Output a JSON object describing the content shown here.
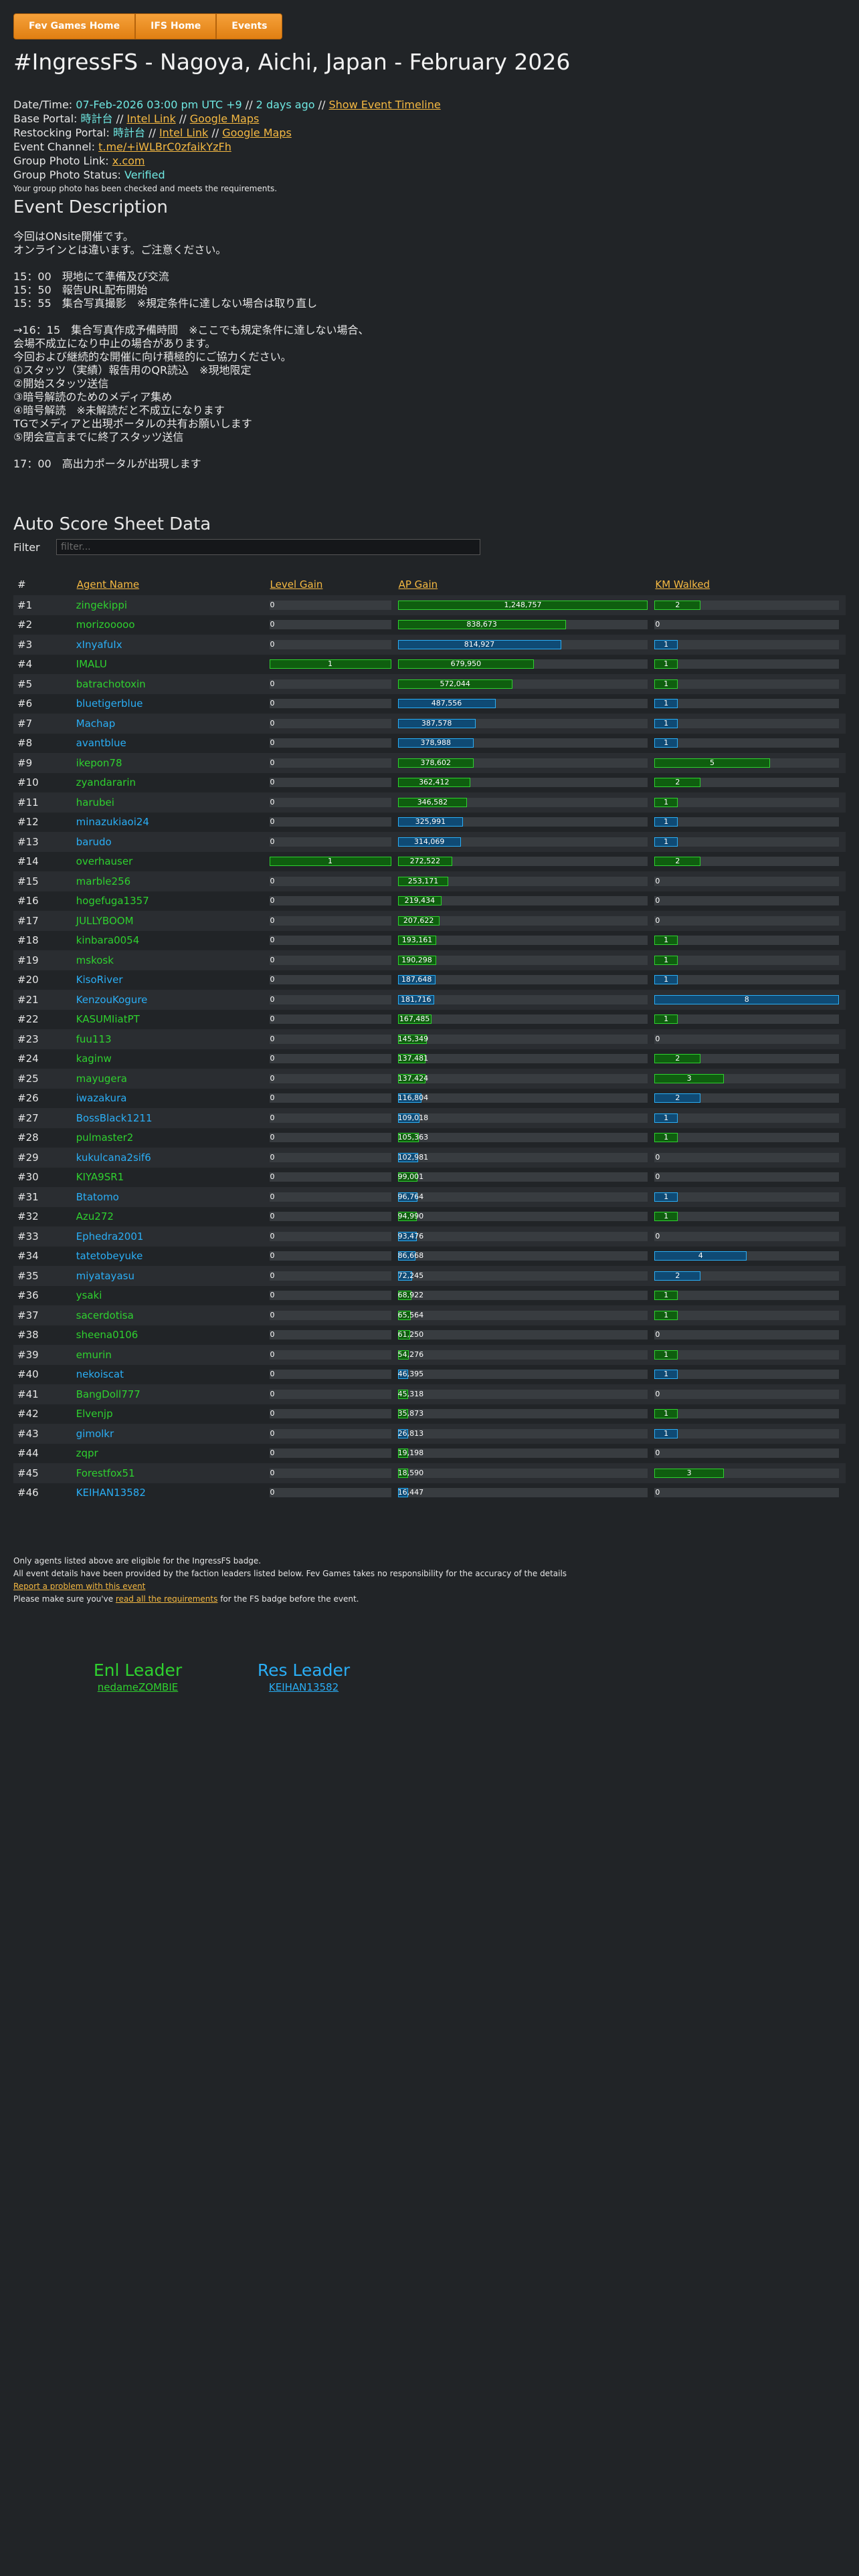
{
  "nav": [
    "Fev Games Home",
    "IFS Home",
    "Events"
  ],
  "title": "#IngressFS - Nagoya, Aichi, Japan - February 2026",
  "info": {
    "datetime_label": "Date/Time: ",
    "datetime_value": "07-Feb-2026 03:00 pm UTC +9",
    "sep1": " // ",
    "ago": "2 days ago",
    "sep2": " // ",
    "timeline_link": "Show Event Timeline",
    "base_label": "Base Portal: ",
    "base_name": "時計台",
    "base_sep1": " // ",
    "base_intel": "Intel Link",
    "base_sep2": " // ",
    "base_maps": "Google Maps",
    "restock_label": "Restocking Portal: ",
    "restock_name": "時計台",
    "restock_sep1": " // ",
    "restock_intel": "Intel Link",
    "restock_sep2": " // ",
    "restock_maps": "Google Maps",
    "channel_label": "Event Channel: ",
    "channel_link": "t.me/+iWLBrC0zfaikYzFh",
    "photo_label": "Group Photo Link: ",
    "photo_link": "x.com",
    "status_label": "Group Photo Status: ",
    "status_value": "Verified",
    "note": "Your group photo has been checked and meets the requirements."
  },
  "desc_title": "Event Description",
  "description": "今回はONsite開催です。\nオンラインとは違います。ご注意ください。\n\n15：00　現地にて準備及び交流\n15：50　報告URL配布開始\n15：55　集合写真撮影　※規定条件に達しない場合は取り直し\n\n→16：15　集合写真作成予備時間　※ここでも規定条件に達しない場合、\n会場不成立になり中止の場合があります。\n今回および継続的な開催に向け積極的にご協力ください。\n①スタッツ（実績）報告用のQR読込　※現地限定\n②開始スタッツ送信\n③暗号解読のためのメディア集め\n④暗号解読　※未解読だと不成立になります\nTGでメディアと出現ポータルの共有お願いします\n⑤閉会宣言までに終了スタッツ送信\n\n17：00　高出力ポータルが出現します",
  "score_title": "Auto Score Sheet Data",
  "filter_label": "Filter",
  "filter_placeholder": "filter...",
  "columns": {
    "rank": "#",
    "name": "Agent Name",
    "level": "Level Gain",
    "ap": "AP Gain",
    "km": "KM Walked"
  },
  "max": {
    "level": 1,
    "ap": 1248757,
    "km": 8
  },
  "rows": [
    {
      "rank": "#1",
      "name": "zingekippi",
      "faction": "enl",
      "level": "0",
      "ap": "1,248,757",
      "km": "2"
    },
    {
      "rank": "#2",
      "name": "morizooooo",
      "faction": "enl",
      "level": "0",
      "ap": "838,673",
      "km": "0"
    },
    {
      "rank": "#3",
      "name": "xInyafuIx",
      "faction": "res",
      "level": "0",
      "ap": "814,927",
      "km": "1"
    },
    {
      "rank": "#4",
      "name": "IMALU",
      "faction": "enl",
      "level": "1",
      "ap": "679,950",
      "km": "1"
    },
    {
      "rank": "#5",
      "name": "batrachotoxin",
      "faction": "enl",
      "level": "0",
      "ap": "572,044",
      "km": "1"
    },
    {
      "rank": "#6",
      "name": "bluetigerblue",
      "faction": "res",
      "level": "0",
      "ap": "487,556",
      "km": "1"
    },
    {
      "rank": "#7",
      "name": "Machap",
      "faction": "res",
      "level": "0",
      "ap": "387,578",
      "km": "1"
    },
    {
      "rank": "#8",
      "name": "avantblue",
      "faction": "res",
      "level": "0",
      "ap": "378,988",
      "km": "1"
    },
    {
      "rank": "#9",
      "name": "ikepon78",
      "faction": "enl",
      "level": "0",
      "ap": "378,602",
      "km": "5"
    },
    {
      "rank": "#10",
      "name": "zyandararin",
      "faction": "enl",
      "level": "0",
      "ap": "362,412",
      "km": "2"
    },
    {
      "rank": "#11",
      "name": "harubei",
      "faction": "enl",
      "level": "0",
      "ap": "346,582",
      "km": "1"
    },
    {
      "rank": "#12",
      "name": "minazukiaoi24",
      "faction": "res",
      "level": "0",
      "ap": "325,991",
      "km": "1"
    },
    {
      "rank": "#13",
      "name": "barudo",
      "faction": "res",
      "level": "0",
      "ap": "314,069",
      "km": "1"
    },
    {
      "rank": "#14",
      "name": "overhauser",
      "faction": "enl",
      "level": "1",
      "ap": "272,522",
      "km": "2"
    },
    {
      "rank": "#15",
      "name": "marble256",
      "faction": "enl",
      "level": "0",
      "ap": "253,171",
      "km": "0"
    },
    {
      "rank": "#16",
      "name": "hogefuga1357",
      "faction": "enl",
      "level": "0",
      "ap": "219,434",
      "km": "0"
    },
    {
      "rank": "#17",
      "name": "JULLYBOOM",
      "faction": "enl",
      "level": "0",
      "ap": "207,622",
      "km": "0"
    },
    {
      "rank": "#18",
      "name": "kinbara0054",
      "faction": "enl",
      "level": "0",
      "ap": "193,161",
      "km": "1"
    },
    {
      "rank": "#19",
      "name": "mskosk",
      "faction": "enl",
      "level": "0",
      "ap": "190,298",
      "km": "1"
    },
    {
      "rank": "#20",
      "name": "KisoRiver",
      "faction": "res",
      "level": "0",
      "ap": "187,648",
      "km": "1"
    },
    {
      "rank": "#21",
      "name": "KenzouKogure",
      "faction": "res",
      "level": "0",
      "ap": "181,716",
      "km": "8"
    },
    {
      "rank": "#22",
      "name": "KASUMIiatPT",
      "faction": "enl",
      "level": "0",
      "ap": "167,485",
      "km": "1"
    },
    {
      "rank": "#23",
      "name": "fuu113",
      "faction": "enl",
      "level": "0",
      "ap": "145,349",
      "km": "0"
    },
    {
      "rank": "#24",
      "name": "kaginw",
      "faction": "enl",
      "level": "0",
      "ap": "137,481",
      "km": "2"
    },
    {
      "rank": "#25",
      "name": "mayugera",
      "faction": "enl",
      "level": "0",
      "ap": "137,424",
      "km": "3"
    },
    {
      "rank": "#26",
      "name": "iwazakura",
      "faction": "res",
      "level": "0",
      "ap": "116,804",
      "km": "2"
    },
    {
      "rank": "#27",
      "name": "BossBlack1211",
      "faction": "res",
      "level": "0",
      "ap": "109,018",
      "km": "1"
    },
    {
      "rank": "#28",
      "name": "pulmaster2",
      "faction": "enl",
      "level": "0",
      "ap": "105,363",
      "km": "1"
    },
    {
      "rank": "#29",
      "name": "kukulcana2sif6",
      "faction": "res",
      "level": "0",
      "ap": "102,981",
      "km": "0"
    },
    {
      "rank": "#30",
      "name": "KIYA9SR1",
      "faction": "enl",
      "level": "0",
      "ap": "99,001",
      "km": "0"
    },
    {
      "rank": "#31",
      "name": "Btatomo",
      "faction": "res",
      "level": "0",
      "ap": "96,764",
      "km": "1"
    },
    {
      "rank": "#32",
      "name": "Azu272",
      "faction": "enl",
      "level": "0",
      "ap": "94,990",
      "km": "1"
    },
    {
      "rank": "#33",
      "name": "Ephedra2001",
      "faction": "res",
      "level": "0",
      "ap": "93,476",
      "km": "0"
    },
    {
      "rank": "#34",
      "name": "tatetobeyuke",
      "faction": "res",
      "level": "0",
      "ap": "86,668",
      "km": "4"
    },
    {
      "rank": "#35",
      "name": "miyatayasu",
      "faction": "res",
      "level": "0",
      "ap": "72,245",
      "km": "2"
    },
    {
      "rank": "#36",
      "name": "ysaki",
      "faction": "enl",
      "level": "0",
      "ap": "68,922",
      "km": "1"
    },
    {
      "rank": "#37",
      "name": "sacerdotisa",
      "faction": "enl",
      "level": "0",
      "ap": "65,564",
      "km": "1"
    },
    {
      "rank": "#38",
      "name": "sheena0106",
      "faction": "enl",
      "level": "0",
      "ap": "61,250",
      "km": "0"
    },
    {
      "rank": "#39",
      "name": "emurin",
      "faction": "enl",
      "level": "0",
      "ap": "54,276",
      "km": "1"
    },
    {
      "rank": "#40",
      "name": "nekoiscat",
      "faction": "res",
      "level": "0",
      "ap": "46,395",
      "km": "1"
    },
    {
      "rank": "#41",
      "name": "BangDoll777",
      "faction": "enl",
      "level": "0",
      "ap": "45,318",
      "km": "0"
    },
    {
      "rank": "#42",
      "name": "Elvenjp",
      "faction": "enl",
      "level": "0",
      "ap": "35,873",
      "km": "1"
    },
    {
      "rank": "#43",
      "name": "gimolkr",
      "faction": "res",
      "level": "0",
      "ap": "26,813",
      "km": "1"
    },
    {
      "rank": "#44",
      "name": "zqpr",
      "faction": "enl",
      "level": "0",
      "ap": "19,198",
      "km": "0"
    },
    {
      "rank": "#45",
      "name": "Forestfox51",
      "faction": "enl",
      "level": "0",
      "ap": "18,590",
      "km": "3"
    },
    {
      "rank": "#46",
      "name": "KEIHAN13582",
      "faction": "res",
      "level": "0",
      "ap": "16,447",
      "km": "0"
    }
  ],
  "footer": {
    "line1": "Only agents listed above are eligible for the IngressFS badge.",
    "line2": "All event details have been provided by the faction leaders listed below. Fev Games takes no responsibility for the accuracy of the details",
    "report_link": "Report a problem with this event",
    "line4_pre": "Please make sure you've ",
    "line4_link": "read all the requirements",
    "line4_post": " for the FS badge before the event."
  },
  "leaders": {
    "enl_title": "Enl Leader",
    "enl_name": "nedameZOMBIE",
    "res_title": "Res Leader",
    "res_name": "KEIHAN13582"
  },
  "colors": {
    "enl": "#2fd12f",
    "res": "#2aaef5",
    "accent": "#f5b942",
    "background": "#212427"
  }
}
